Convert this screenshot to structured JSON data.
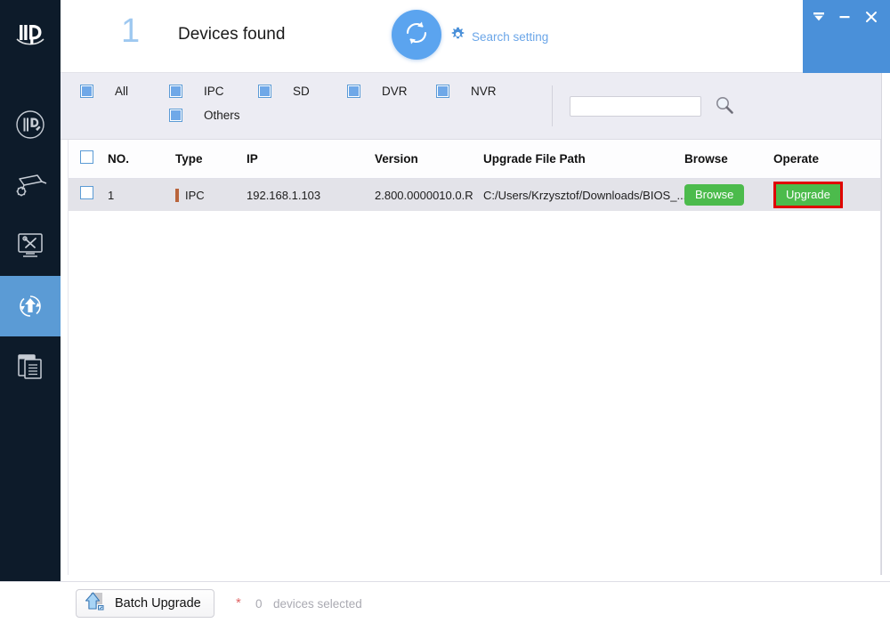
{
  "app": {
    "logo_icon": "id-logo-icon"
  },
  "sidebar": {
    "items": [
      {
        "icon": "ip-config-icon",
        "active": false
      },
      {
        "icon": "device-settings-camera-icon",
        "active": false
      },
      {
        "icon": "tools-monitor-icon",
        "active": false
      },
      {
        "icon": "upgrade-arrow-icon",
        "active": true
      },
      {
        "icon": "files-logs-icon",
        "active": false
      }
    ]
  },
  "header": {
    "device_count": "1",
    "devices_found_label": "Devices found",
    "refresh_icon": "refresh-sync-icon",
    "search_setting_label": "Search setting",
    "search_setting_icon": "gear-icon",
    "window_controls": [
      {
        "icon": "collapse-icon",
        "name": "collapse-button"
      },
      {
        "icon": "minimize-icon",
        "name": "minimize-button"
      },
      {
        "icon": "close-icon",
        "name": "close-button"
      }
    ]
  },
  "filters": {
    "checkboxes": [
      {
        "label": "All",
        "checked": true
      },
      {
        "label": "IPC",
        "checked": true
      },
      {
        "label": "SD",
        "checked": true
      },
      {
        "label": "DVR",
        "checked": true
      },
      {
        "label": "NVR",
        "checked": true
      },
      {
        "label": "Others",
        "checked": true
      }
    ],
    "search": {
      "value": "",
      "placeholder": "",
      "icon": "magnifier-icon"
    }
  },
  "table": {
    "columns": [
      "NO.",
      "Type",
      "IP",
      "Version",
      "Upgrade File Path",
      "Browse",
      "Operate"
    ],
    "rows": [
      {
        "selected": false,
        "no": "1",
        "type": "IPC",
        "type_color": "#b9643c",
        "ip": "192.168.1.103",
        "version": "2.800.0000010.0.R",
        "path": "C:/Users/Krzysztof/Downloads/BIOS_...",
        "browse_label": "Browse",
        "operate_label": "Upgrade",
        "operate_highlight_color": "#e00000"
      }
    ],
    "header_checkbox_checked": false
  },
  "footer": {
    "batch_upgrade_label": "Batch Upgrade",
    "batch_upgrade_icon": "upload-house-icon",
    "asterisk": "*",
    "selected_count": "0",
    "selected_text": "devices selected"
  },
  "colors": {
    "sidebar_bg": "#0d1b2a",
    "accent_blue": "#5b9bd5",
    "filter_bg": "#ececf3",
    "row_bg": "#e3e3e9",
    "green": "#4cbb4c",
    "highlight_red": "#e00000",
    "count_blue": "#9ec8f0"
  }
}
